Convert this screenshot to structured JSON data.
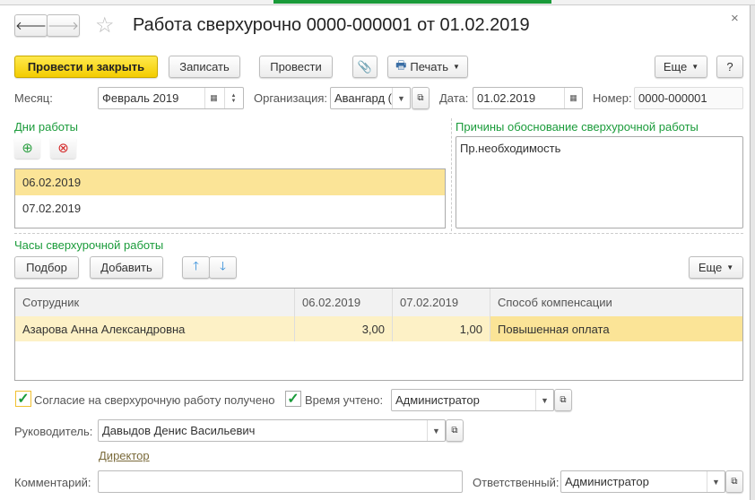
{
  "title": "Работа сверхурочно 0000-000001 от 01.02.2019",
  "toolbar": {
    "post_close": "Провести и закрыть",
    "save": "Записать",
    "post": "Провести",
    "print": "Печать",
    "more": "Еще",
    "help": "?"
  },
  "header": {
    "month_label": "Месяц:",
    "month": "Февраль 2019",
    "org_label": "Организация:",
    "org": "Авангард (",
    "date_label": "Дата:",
    "date": "01.02.2019",
    "number_label": "Номер:",
    "number": "0000-000001"
  },
  "days": {
    "label": "Дни работы",
    "items": [
      "06.02.2019",
      "07.02.2019"
    ]
  },
  "reasons": {
    "label": "Причины обоснование сверхурочной работы",
    "text": "Пр.необходимость"
  },
  "hours": {
    "label": "Часы сверхурочной работы",
    "pick": "Подбор",
    "add": "Добавить",
    "more": "Еще",
    "columns": [
      "Сотрудник",
      "06.02.2019",
      "07.02.2019",
      "Способ компенсации"
    ],
    "rows": [
      [
        "Азарова Анна Александровна",
        "3,00",
        "1,00",
        "Повышенная оплата"
      ]
    ]
  },
  "consent_label": "Согласие на сверхурочную работу получено",
  "consent_checked": true,
  "time_label": "Время учтено:",
  "time_checked": true,
  "time_value": "Администратор",
  "manager_label": "Руководитель:",
  "manager": "Давыдов Денис Васильевич",
  "manager_position": "Директор",
  "comment_label": "Комментарий:",
  "comment": "",
  "responsible_label": "Ответственный:",
  "responsible": "Администратор",
  "colors": {
    "accent": "#1a9b3a",
    "selection": "#fbe497",
    "primary_button": "#f3cc00"
  }
}
